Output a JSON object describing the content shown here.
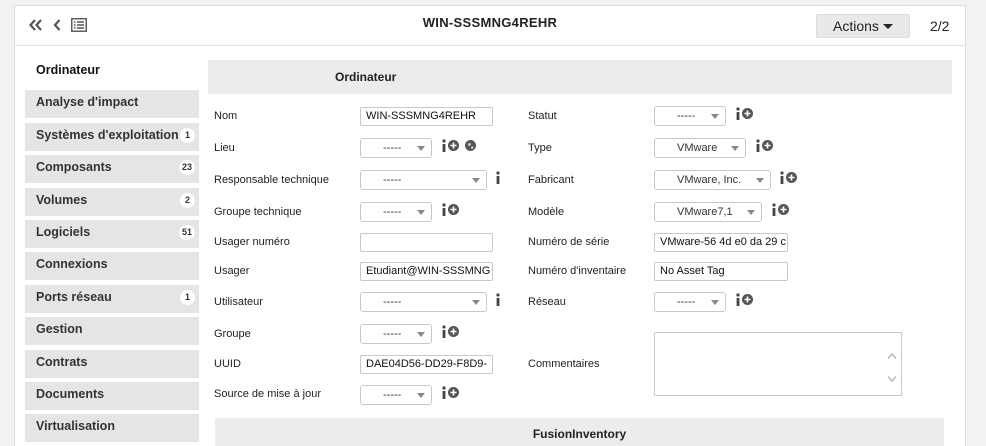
{
  "header": {
    "title": "WIN-SSSMNG4REHR",
    "actions_label": "Actions",
    "pager": "2/2"
  },
  "sidebar": {
    "items": [
      {
        "label": "Ordinateur",
        "badge": ""
      },
      {
        "label": "Analyse d'impact",
        "badge": ""
      },
      {
        "label": "Systèmes d'exploitation",
        "badge": "1"
      },
      {
        "label": "Composants",
        "badge": "23"
      },
      {
        "label": "Volumes",
        "badge": "2"
      },
      {
        "label": "Logiciels",
        "badge": "51"
      },
      {
        "label": "Connexions",
        "badge": ""
      },
      {
        "label": "Ports réseau",
        "badge": "1"
      },
      {
        "label": "Gestion",
        "badge": ""
      },
      {
        "label": "Contrats",
        "badge": ""
      },
      {
        "label": "Documents",
        "badge": ""
      },
      {
        "label": "Virtualisation",
        "badge": ""
      },
      {
        "label": "",
        "badge": ""
      }
    ]
  },
  "form": {
    "section_title": "Ordinateur",
    "nom_label": "Nom",
    "nom_value": "WIN-SSSMNG4REHR",
    "statut_label": "Statut",
    "statut_value": "-----",
    "lieu_label": "Lieu",
    "lieu_value": "-----",
    "type_label": "Type",
    "type_value": "VMware",
    "resp_label": "Responsable technique",
    "resp_value": "-----",
    "fabricant_label": "Fabricant",
    "fabricant_value": "VMware, Inc.",
    "groupe_tech_label": "Groupe technique",
    "groupe_tech_value": "-----",
    "modele_label": "Modèle",
    "modele_value": "VMware7,1",
    "usager_num_label": "Usager numéro",
    "usager_num_value": "",
    "serie_label": "Numéro de série",
    "serie_value": "VMware-56 4d e0 da 29 c",
    "usager_label": "Usager",
    "usager_value": "Etudiant@WIN-SSSMNG",
    "inventaire_label": "Numéro d'inventaire",
    "inventaire_value": "No Asset Tag",
    "utilisateur_label": "Utilisateur",
    "utilisateur_value": "-----",
    "reseau_label": "Réseau",
    "reseau_value": "-----",
    "groupe_label": "Groupe",
    "groupe_value": "-----",
    "uuid_label": "UUID",
    "uuid_value": "DAE04D56-DD29-F8D9-",
    "commentaires_label": "Commentaires",
    "commentaires_value": "",
    "source_label": "Source de mise à jour",
    "source_value": "-----"
  },
  "fusion": {
    "title": "FusionInventory"
  },
  "colors": {
    "sidebar_bg": "#e5e5e5",
    "header_bg": "#ececec",
    "button_bg": "#e9e9e9"
  },
  "icons": [
    "double-chevron-left-icon",
    "chevron-left-icon",
    "list-icon",
    "info-icon",
    "plus-circle-icon",
    "globe-icon",
    "caret-down-icon"
  ]
}
